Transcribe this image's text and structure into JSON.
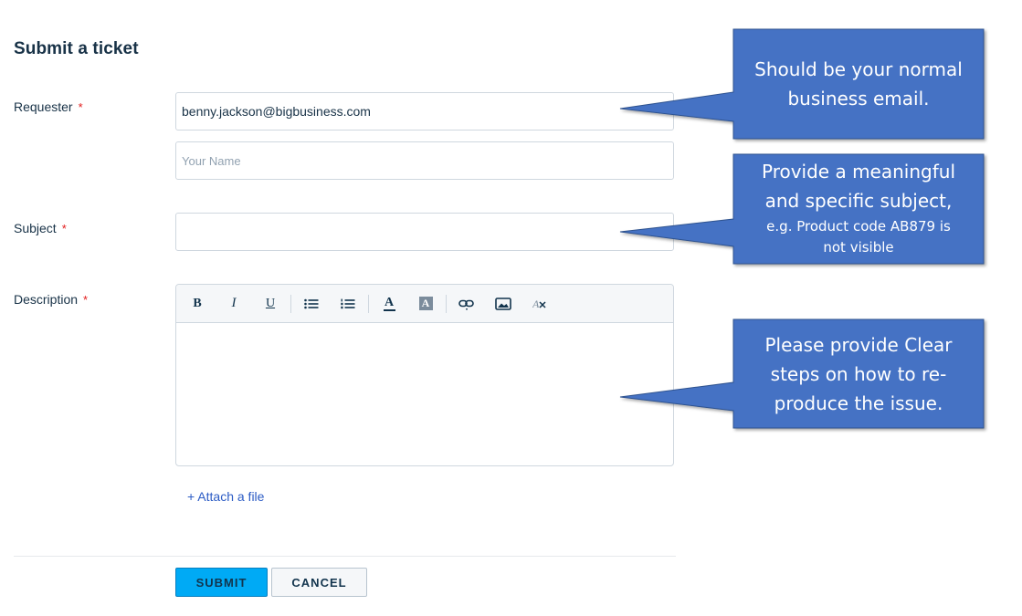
{
  "form": {
    "title": "Submit a ticket",
    "required_marker": "*",
    "requester": {
      "label": "Requester",
      "email_value": "benny.jackson@bigbusiness.com",
      "name_placeholder": "Your Name"
    },
    "subject": {
      "label": "Subject",
      "value": ""
    },
    "description": {
      "label": "Description",
      "toolbar": {
        "bold": "B",
        "italic": "I",
        "underline": "U",
        "text_color": "A",
        "bg_color": "A"
      }
    },
    "attach_label": "+ Attach a file",
    "submit_label": "SUBMIT",
    "cancel_label": "CANCEL"
  },
  "callouts": {
    "email": {
      "line1": "Should be your normal",
      "line2": "business email."
    },
    "subject": {
      "line1": "Provide a meaningful",
      "line2": "and specific subject,",
      "line3": "e.g. Product code AB879 is",
      "line4": "not visible"
    },
    "description": {
      "line1": "Please provide Clear",
      "line2": "steps on how to re-",
      "line3": "produce the issue."
    }
  },
  "colors": {
    "callout_fill": "#4472c4",
    "callout_stroke": "#2f528f",
    "submit_bg": "#00aaf5",
    "required": "#e21b1b",
    "link": "#2c5cc5"
  }
}
